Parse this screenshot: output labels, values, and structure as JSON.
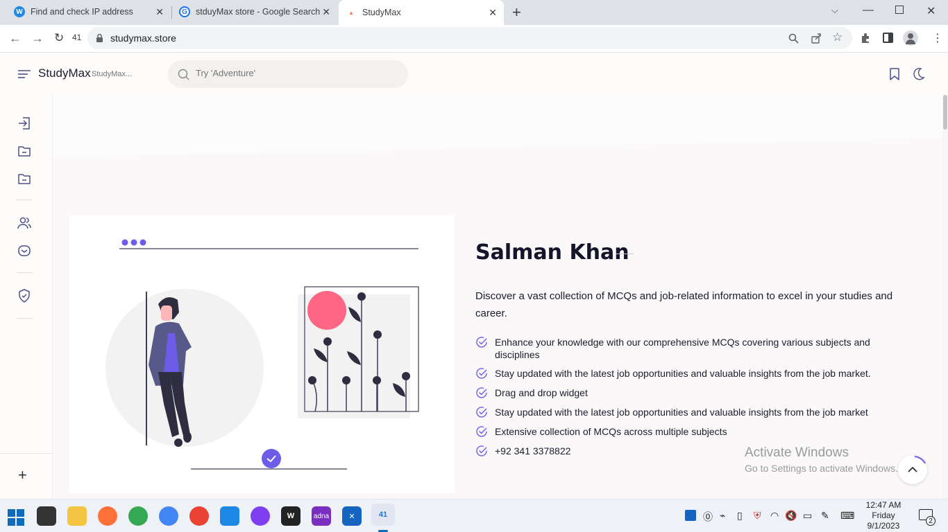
{
  "browser": {
    "tabs": [
      {
        "title": "Find and check IP address",
        "favicon_color": "#1e88e5",
        "favicon_letter": "W"
      },
      {
        "title": "stduyMax store - Google Search",
        "favicon_color": "#1a73e8",
        "favicon_letter": "G"
      },
      {
        "title": "StudyMax",
        "favicon_color": "#f57c4b",
        "favicon_letter": "▲"
      }
    ],
    "new_tab_symbol": "+",
    "reload_badge": "41",
    "url": "studymax.store"
  },
  "site": {
    "brand": "StudyMax",
    "brand_sub": "StudyMax...",
    "search_placeholder": "Try 'Adventure'",
    "accent_color": "#6c5ce7"
  },
  "profile": {
    "name": "Salman Khan",
    "intro": "Discover a vast collection of MCQs and job-related information to excel in your studies and career.",
    "features": [
      "Enhance your knowledge with our comprehensive MCQs covering various subjects and disciplines",
      "Stay updated with the latest job opportunities and valuable insights from the job market.",
      "Drag and drop widget",
      "Stay updated with the latest job opportunities and valuable insights from the job market",
      "Extensive collection of MCQs across multiple subjects",
      "+92 341 3378822"
    ]
  },
  "watermark": {
    "title": "Activate Windows",
    "subtitle": "Go to Settings to activate Windows."
  },
  "taskbar": {
    "time": "12:47 AM",
    "day": "Friday",
    "date": "9/1/2023",
    "notification_count": "2",
    "active_app_badge": "41",
    "adna_label": "adna"
  }
}
